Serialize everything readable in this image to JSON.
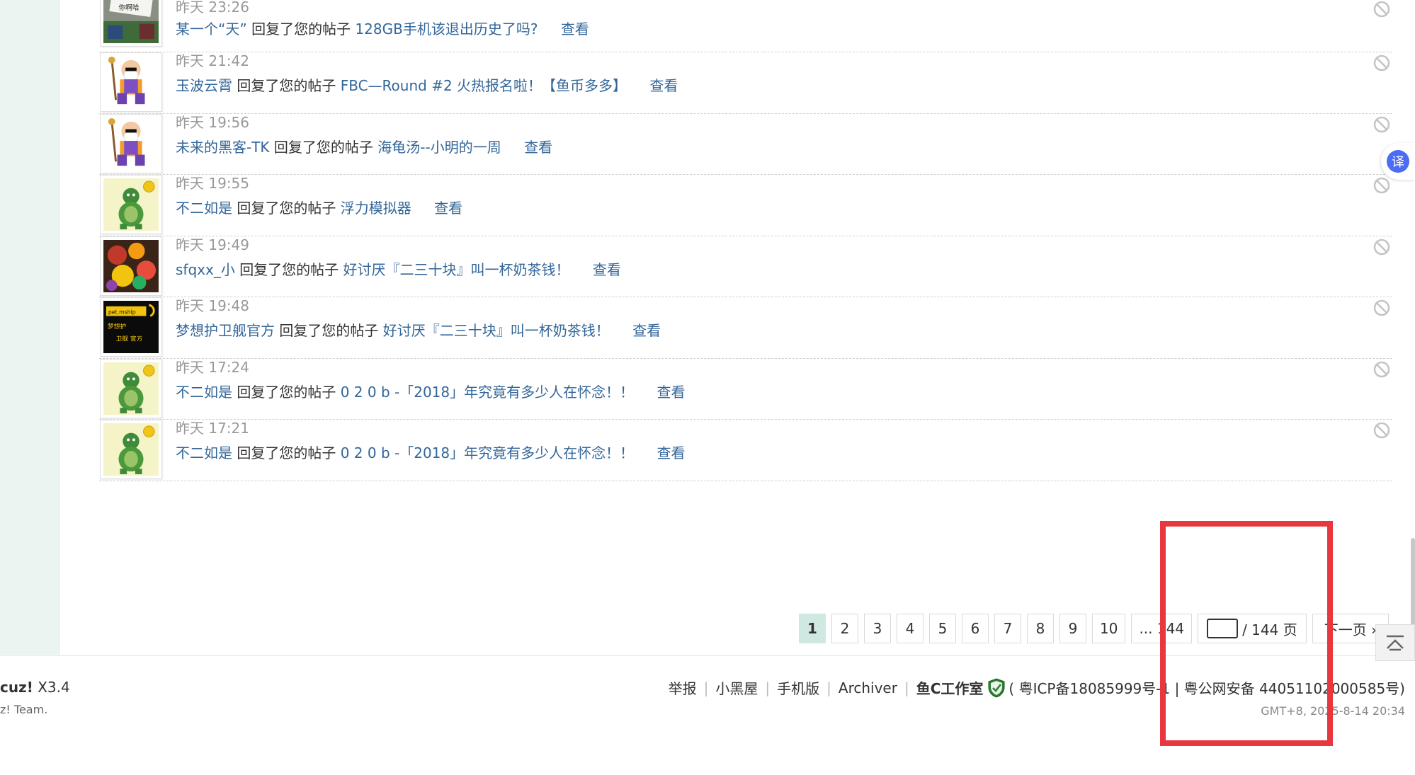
{
  "notices": [
    {
      "time": "昨天 23:26",
      "user": "某一个“天”",
      "action": "回复了您的帖子",
      "thread": "128GB手机该退出历史了吗?",
      "view": "查看",
      "avatar": "photo-sign"
    },
    {
      "time": "昨天 21:42",
      "user": "玉波云霄",
      "action": "回复了您的帖子",
      "thread": "FBC—Round #2 火热报名啦！【鱼币多多】",
      "view": "查看",
      "avatar": "old-master"
    },
    {
      "time": "昨天 19:56",
      "user": "未来的黑客-TK",
      "action": "回复了您的帖子",
      "thread": "海龟汤--小明的一周",
      "view": "查看",
      "avatar": "old-master"
    },
    {
      "time": "昨天 19:55",
      "user": "不二如是",
      "action": "回复了您的帖子",
      "thread": "浮力模拟器",
      "view": "查看",
      "avatar": "green-turtle"
    },
    {
      "time": "昨天 19:49",
      "user": "sfqxx_小",
      "action": "回复了您的帖子",
      "thread": "好讨厌『二三十块』叫一杯奶茶钱！",
      "view": "查看",
      "avatar": "fruit-photo"
    },
    {
      "time": "昨天 19:48",
      "user": "梦想护卫舰官方",
      "action": "回复了您的帖子",
      "thread": "好讨厌『二三十块』叫一杯奶茶钱！",
      "view": "查看",
      "avatar": "dream-logo"
    },
    {
      "time": "昨天 17:24",
      "user": "不二如是",
      "action": "回复了您的帖子",
      "thread": "0 2 0 b -「2018」年究竟有多少人在怀念！！",
      "view": "查看",
      "avatar": "green-turtle"
    },
    {
      "time": "昨天 17:21",
      "user": "不二如是",
      "action": "回复了您的帖子",
      "thread": "0 2 0 b -「2018」年究竟有多少人在怀念！！",
      "view": "查看",
      "avatar": "green-turtle"
    }
  ],
  "pager": {
    "pages": [
      "1",
      "2",
      "3",
      "4",
      "5",
      "6",
      "7",
      "8",
      "9",
      "10"
    ],
    "current": "1",
    "last": "... 144",
    "input_value": "",
    "total_label": "/ 144 页",
    "next_label": "下一页 ›"
  },
  "footer": {
    "powered_brand": "cuz!",
    "powered_version": "X3.4",
    "copyright": "z! Team.",
    "links": [
      "举报",
      "小黑屋",
      "手机版",
      "Archiver"
    ],
    "studio": "鱼C工作室",
    "icp": "( 粤ICP备18085999号-1 | 粤公网安备 44051102000585号)",
    "gmt": "GMT+8, 2025-8-14 20:34"
  },
  "translate_label": "译",
  "colors": {
    "link": "#336699",
    "current_page_bg": "#cfe8e2",
    "left_strip": "#eaf5f2",
    "highlight": "#e8373e"
  }
}
